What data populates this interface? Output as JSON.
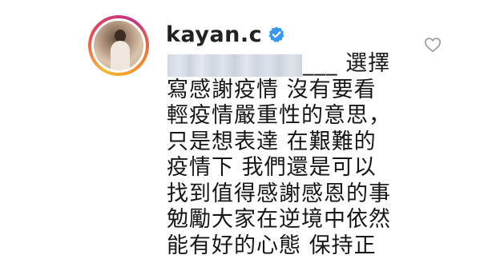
{
  "comment": {
    "username": "kayan.c",
    "verified_icon": "verified-badge-icon",
    "like_icon": "heart-outline-icon",
    "colors": {
      "verified": "#3897f0",
      "text": "#161616",
      "username": "#222222",
      "like_icon": "#999999"
    },
    "lines": [
      "___ 選擇",
      "寫感謝疫情 沒有要看",
      "輕疫情嚴重性的意思，",
      "只是想表達 在艱難的",
      "疫情下 我們還是可以",
      "找到值得感謝感恩的事",
      "勉勵大家在逆境中依然",
      "能有好的心態 保持正"
    ]
  }
}
